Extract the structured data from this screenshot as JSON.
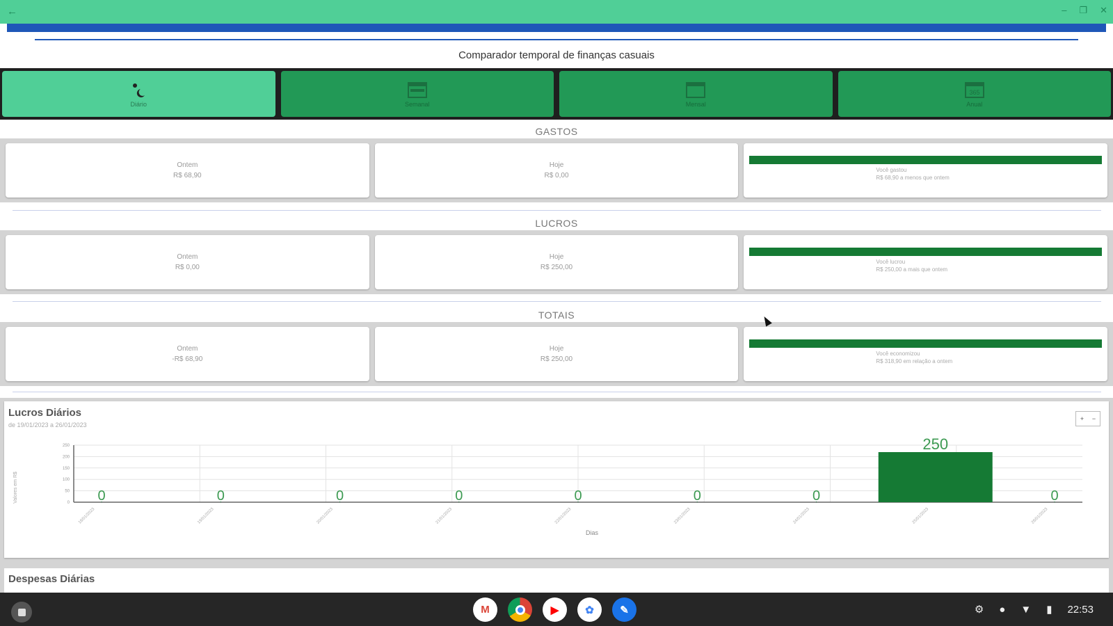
{
  "window": {
    "back_icon": "arrow-left-icon",
    "minimize": "–",
    "maximize": "❐",
    "close": "✕"
  },
  "app": {
    "title": "Comparador temporal de finanças casuais"
  },
  "tabs": [
    {
      "label": "Diário",
      "icon": "sun-moon-icon",
      "active": true
    },
    {
      "label": "Semanal",
      "icon": "calendar-week-icon",
      "active": false
    },
    {
      "label": "Mensal",
      "icon": "calendar-month-icon",
      "active": false
    },
    {
      "label": "Anual",
      "icon": "calendar-year-icon",
      "active": false
    }
  ],
  "sections": {
    "gastos": {
      "title": "GASTOS",
      "ontem_label": "Ontem",
      "ontem_value": "R$ 68,90",
      "hoje_label": "Hoje",
      "hoje_value": "R$ 0,00",
      "bar_fill": 1.0,
      "comparison_line1": "Você gastou",
      "comparison_line2": "R$ 68,90 a menos que ontem"
    },
    "lucros": {
      "title": "LUCROS",
      "ontem_label": "Ontem",
      "ontem_value": "R$ 0,00",
      "hoje_label": "Hoje",
      "hoje_value": "R$ 250,00",
      "bar_fill": 1.0,
      "comparison_line1": "Você lucrou",
      "comparison_line2": "R$ 250,00 a mais que ontem"
    },
    "totais": {
      "title": "TOTAIS",
      "ontem_label": "Ontem",
      "ontem_value": "-R$ 68,90",
      "hoje_label": "Hoje",
      "hoje_value": "R$ 250,00",
      "bar_fill": 1.0,
      "comparison_line1": "Você economizou",
      "comparison_line2": "R$ 318,90 em relação a ontem"
    }
  },
  "chart": {
    "title": "Lucros Diários",
    "subtitle": "de 19/01/2023 a 26/01/2023",
    "zoom_icon": "zoom-icon"
  },
  "chart_data": {
    "type": "bar",
    "categories": [
      "18/01/2023",
      "19/01/2023",
      "20/01/2023",
      "21/01/2023",
      "22/01/2023",
      "23/01/2023",
      "24/01/2023",
      "25/01/2023",
      "26/01/2023"
    ],
    "values": [
      0,
      0,
      0,
      0,
      0,
      0,
      0,
      250,
      0
    ],
    "value_labels": [
      "0",
      "0",
      "0",
      "0",
      "0",
      "0",
      "0",
      "250",
      "0"
    ],
    "xlabel": "Dias",
    "ylabel": "Valores em R$",
    "yticks": [
      "250",
      "200",
      "150",
      "100",
      "50",
      "0"
    ],
    "ylim": [
      0,
      250
    ],
    "grid": true,
    "bar_color": "#157a34",
    "label_color": "#3d9a52"
  },
  "chart2": {
    "title": "Despesas Diárias"
  },
  "taskbar": {
    "apps": [
      {
        "name": "gmail-icon",
        "glyph": "M",
        "color": "#ffffff"
      },
      {
        "name": "chrome-icon",
        "glyph": "",
        "color": "#db4437"
      },
      {
        "name": "youtube-icon",
        "glyph": "▶",
        "color": "#ff0000"
      },
      {
        "name": "photos-icon",
        "glyph": "✿",
        "color": "#ffffff"
      },
      {
        "name": "finance-app-icon",
        "glyph": "✎",
        "color": "#1a73e8"
      }
    ],
    "time": "22:53"
  }
}
